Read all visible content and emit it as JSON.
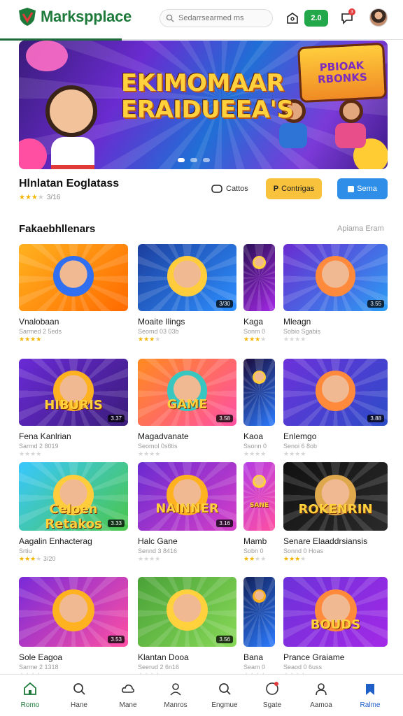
{
  "header": {
    "brand": "Markspplace",
    "search_placeholder": "Sedarrsearmed ms",
    "coins": "2.0",
    "notif_count": "3",
    "colors": {
      "brand_green": "#1d7a3a",
      "accent_green": "#22a84a",
      "accent_yellow": "#f9c23c",
      "accent_blue": "#2f8fe8"
    }
  },
  "hero": {
    "title_line1": "EKIMOMAAR",
    "title_line2": "ERAIDUEEA'S",
    "badge_line1": "PBIOAK",
    "badge_line2": "RBONKS",
    "slide_index": 1,
    "slide_count": 3
  },
  "featured": {
    "title": "Hlnlatan Eoglatass",
    "rating": 3,
    "rating_text": "3/16",
    "action_outline": "Cattos",
    "action_yellow": "Contrigas",
    "action_blue": "Sema"
  },
  "section": {
    "title": "Fakaebhllenars",
    "link": "Apiama Eram"
  },
  "games": [
    {
      "title": "Vnalobaan",
      "sub": "Sarmed 2 5eds",
      "stars": 4,
      "chip": "",
      "art": ""
    },
    {
      "title": "Moaite Ilings",
      "sub": "Seomd 03 03b",
      "stars": 3,
      "chip": "3/30",
      "art": ""
    },
    {
      "title": "Kaga",
      "sub": "Sonm 0",
      "stars": 3,
      "chip": "",
      "art": ""
    },
    {
      "title": "Mleagn",
      "sub": "Sobio Sgabis",
      "stars": 0,
      "chip": "3.55",
      "art": ""
    },
    {
      "title": "Fena Kanlrian",
      "sub": "Sarmd 2 8019",
      "stars": 0,
      "chip": "3.37",
      "art": "HIBURIS"
    },
    {
      "title": "Magadvanate",
      "sub": "Seomol 0s6tis",
      "stars": 0,
      "chip": "3.58",
      "art": "GAME"
    },
    {
      "title": "Kaoa",
      "sub": "Ssonn 0",
      "stars": 0,
      "chip": "",
      "art": ""
    },
    {
      "title": "Enlemgo",
      "sub": "Senoi 6 8ob",
      "stars": 0,
      "chip": "3.88",
      "art": ""
    },
    {
      "title": "Aagalin Enhacterag",
      "sub": "Srtiu",
      "stars": 3,
      "chip": "3.33",
      "art": "Celoen Retakos",
      "rating_text": "3/20"
    },
    {
      "title": "Halc Gane",
      "sub": "Sennd 3 8416",
      "stars": 0,
      "chip": "3.16",
      "art": "NAINNER"
    },
    {
      "title": "Mamb",
      "sub": "Sobn 0",
      "stars": 2,
      "chip": "",
      "art": "SANE"
    },
    {
      "title": "Senare Elaaddrsiansis",
      "sub": "Sonnd 0 Hoas",
      "stars": 3,
      "chip": "",
      "art": "ROKENRIN"
    },
    {
      "title": "Sole Eagoa",
      "sub": "Sarme 2 1318",
      "stars": 0,
      "chip": "3.53",
      "art": ""
    },
    {
      "title": "Klantan Dooa",
      "sub": "Seerud 2 6n16",
      "stars": 0,
      "chip": "3.56",
      "art": ""
    },
    {
      "title": "Bana",
      "sub": "Seam 0",
      "stars": 0,
      "chip": "",
      "art": ""
    },
    {
      "title": "Prance Graiame",
      "sub": "Seaod 0 6uss",
      "stars": 0,
      "chip": "",
      "art": "BOUDS"
    }
  ],
  "nav": [
    {
      "label": "Romo",
      "icon": "home-icon"
    },
    {
      "label": "Hane",
      "icon": "search-icon"
    },
    {
      "label": "Mane",
      "icon": "cloud-icon"
    },
    {
      "label": "Manros",
      "icon": "user-icon"
    },
    {
      "label": "Engmue",
      "icon": "search-icon"
    },
    {
      "label": "Sgate",
      "icon": "compass-icon"
    },
    {
      "label": "Aamoa",
      "icon": "profile-icon"
    },
    {
      "label": "Ralme",
      "icon": "bookmark-icon"
    }
  ]
}
